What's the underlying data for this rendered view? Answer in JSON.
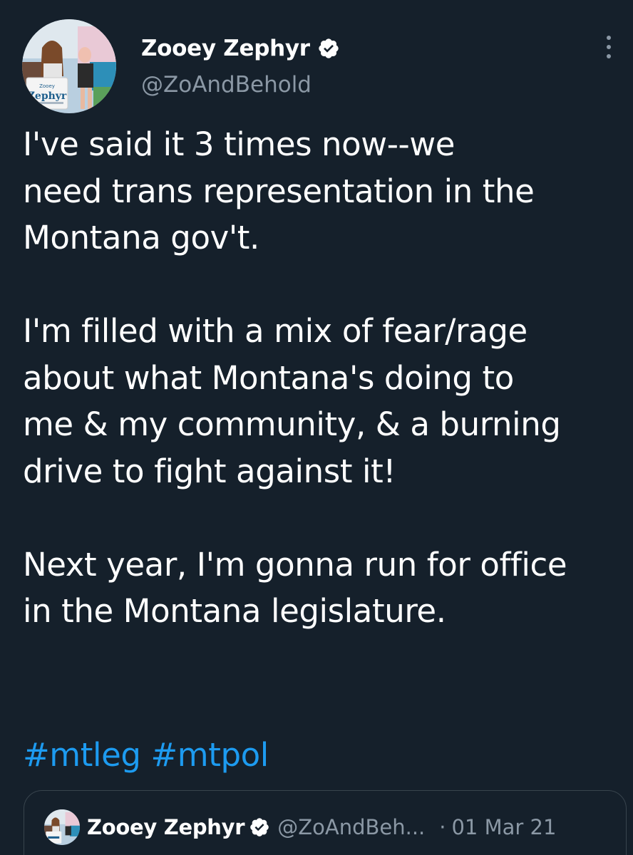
{
  "author": {
    "display_name": "Zooey Zephyr",
    "handle": "@ZoAndBehold",
    "verified": true,
    "avatar_icon": "profile-photo",
    "avatar_sign_text": [
      "Zooey",
      "Zephyr"
    ]
  },
  "tweet": {
    "paragraphs": [
      [
        "I've said it 3 times now--we",
        "need trans representation in the",
        "Montana gov't."
      ],
      [
        "I'm filled with a mix of fear/rage",
        "about what Montana's doing to",
        "me & my community, & a burning",
        "drive to fight against it!"
      ],
      [
        "Next year, I'm gonna run for office",
        "in the Montana legislature."
      ]
    ],
    "hashtags": [
      "#mtleg",
      "#mtpol"
    ]
  },
  "quoted_tweet": {
    "display_name": "Zooey Zephyr",
    "handle": "@ZoAndBeh...",
    "separator": "·",
    "date": "01 Mar 21",
    "verified": true
  },
  "icons": {
    "verified": "verified-badge-icon",
    "more": "more-vertical-icon"
  },
  "colors": {
    "background": "#15202b",
    "text": "#ffffff",
    "secondary_text": "#8b98a5",
    "link": "#1d9bf0",
    "border": "#38444d"
  }
}
